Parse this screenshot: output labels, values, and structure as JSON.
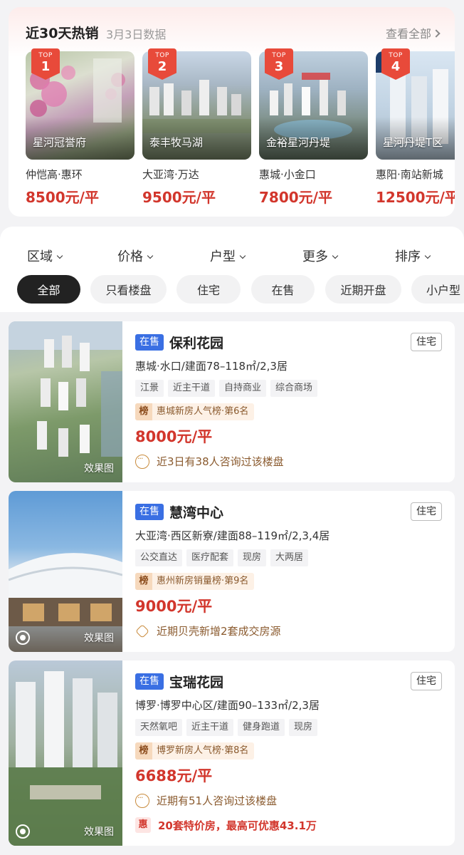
{
  "hot": {
    "title": "近30天热销",
    "subtitle": "3月3日数据",
    "view_all": "查看全部",
    "top_label": "TOP",
    "items": [
      {
        "rank": "1",
        "name": "星河冠誉府",
        "location": "仲恺高·惠环",
        "price": "8500元/平"
      },
      {
        "rank": "2",
        "name": "泰丰牧马湖",
        "location": "大亚湾·万达",
        "price": "9500元/平"
      },
      {
        "rank": "3",
        "name": "金裕星河丹堤",
        "location": "惠城·小金口",
        "price": "7800元/平"
      },
      {
        "rank": "4",
        "name": "星河丹堤T区",
        "location": "惠阳·南站新城",
        "price": "12500元/平"
      }
    ]
  },
  "filters": [
    "区域",
    "价格",
    "户型",
    "更多",
    "排序"
  ],
  "chips": [
    "全部",
    "只看楼盘",
    "住宅",
    "在售",
    "近期开盘",
    "小户型"
  ],
  "listings": [
    {
      "status": "在售",
      "name": "保利花园",
      "type": "住宅",
      "area": "惠城·水口/建面78–118㎡/2,3居",
      "tags": [
        "江景",
        "近主干道",
        "自持商业",
        "综合商场"
      ],
      "rank_badge": "榜",
      "rank": "惠城新房人气榜·第6名",
      "price": "8000元/平",
      "note": "近3日有38人咨询过该楼盘",
      "img_label": "效果图"
    },
    {
      "status": "在售",
      "name": "慧湾中心",
      "type": "住宅",
      "area": "大亚湾·西区新寮/建面88–119㎡/2,3,4居",
      "tags": [
        "公交直达",
        "医疗配套",
        "现房",
        "大两居"
      ],
      "rank_badge": "榜",
      "rank": "惠州新房销量榜·第9名",
      "price": "9000元/平",
      "note": "近期贝壳新增2套成交房源",
      "img_label": "效果图"
    },
    {
      "status": "在售",
      "name": "宝瑞花园",
      "type": "住宅",
      "area": "博罗·博罗中心区/建面90–133㎡/2,3居",
      "tags": [
        "天然氧吧",
        "近主干道",
        "健身跑道",
        "现房"
      ],
      "rank_badge": "榜",
      "rank": "博罗新房人气榜·第8名",
      "price": "6688元/平",
      "note": "近期有51人咨询过该楼盘",
      "promo_badge": "惠",
      "promo": "20套特价房，最高可优惠43.1万",
      "img_label": "效果图"
    }
  ]
}
